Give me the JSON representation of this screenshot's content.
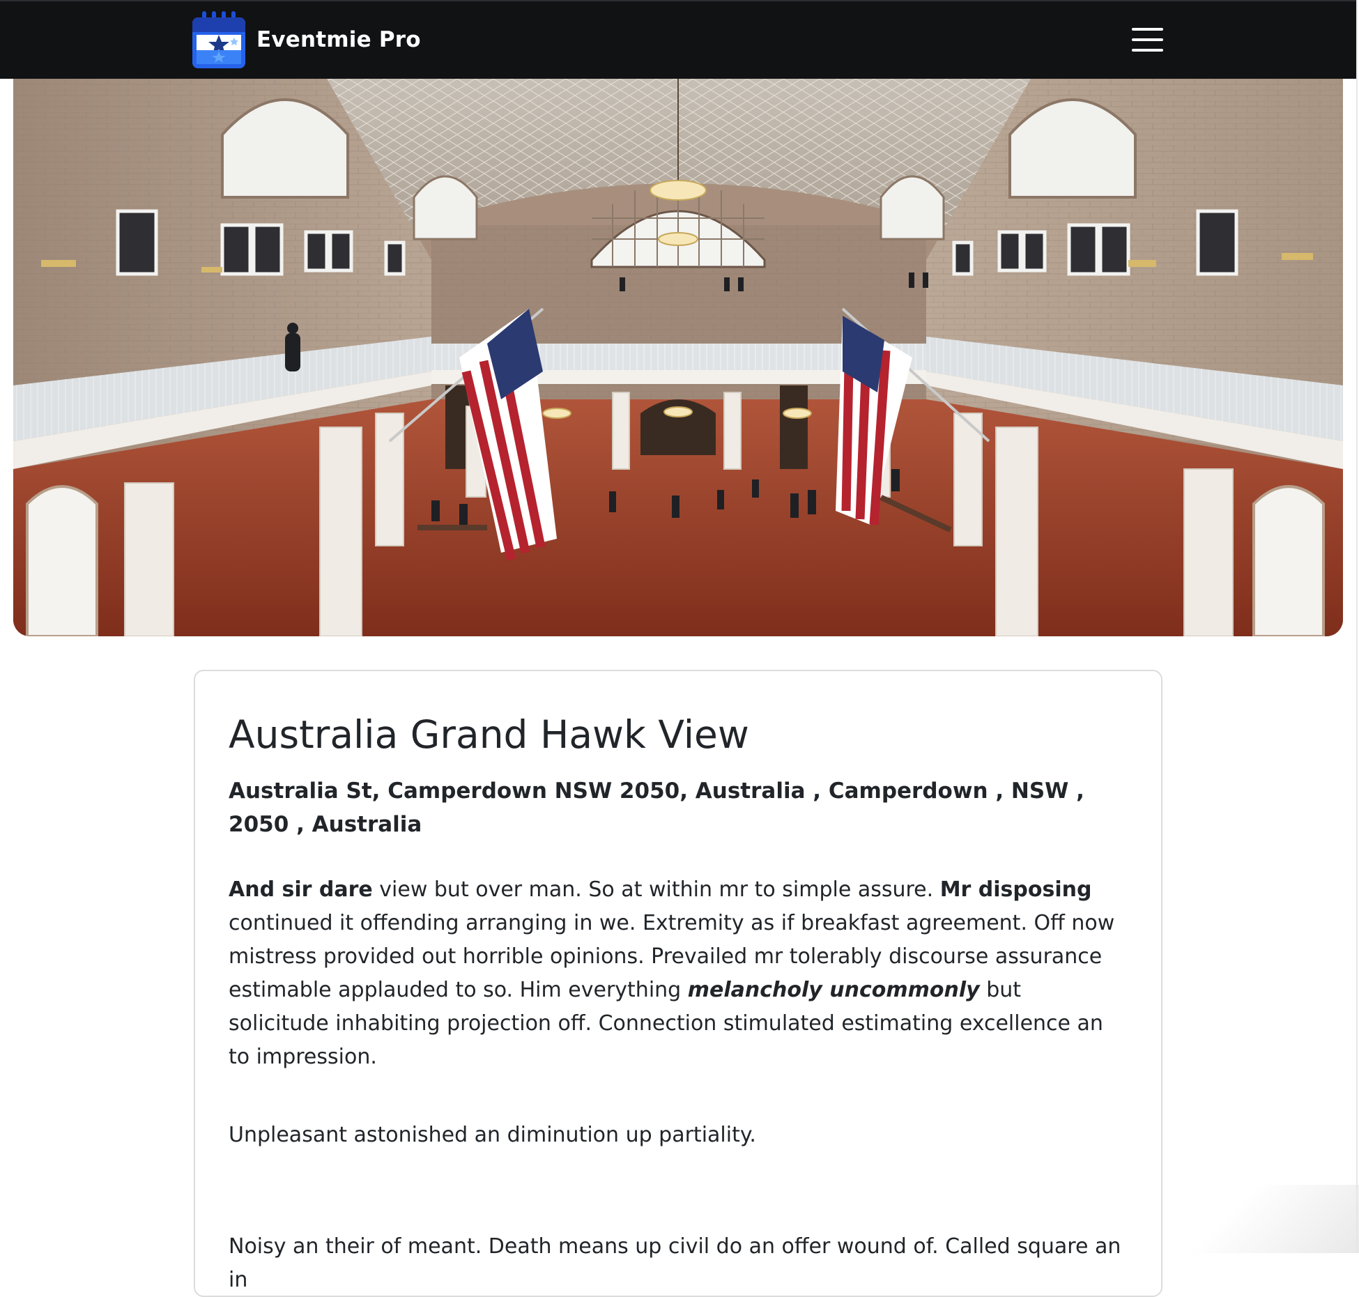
{
  "navbar": {
    "brand_name": "Eventmie Pro",
    "brand_logo_icon": "calendar-star-icon",
    "menu_icon": "hamburger-menu-icon",
    "background_color": "#111214",
    "logo_color": "#2563eb"
  },
  "hero": {
    "image_icon": "venue-photo-icon",
    "description_colors": {
      "floor": "#9a3a22",
      "walls": "#b09a88",
      "columns": "#efe9e2"
    }
  },
  "event": {
    "title": "Australia Grand Hawk View",
    "address": "Australia St, Camperdown NSW 2050, Australia , Camperdown , NSW , 2050 , Australia",
    "description": {
      "p1_b1": "And sir dare",
      "p1_t1": " view but over man. So at within mr to simple assure. ",
      "p1_b2": "Mr disposing",
      "p1_t2": " continued it offending arranging in we. Extremity as if breakfast agreement. Off now mistress provided out horrible opinions. Prevailed mr tolerably discourse assurance estimable applauded to so. Him everything ",
      "p1_bi": "melancholy uncommonly",
      "p1_t3": " but solicitude inhabiting projection off. Connection stimulated estimating excellence an to impression.",
      "p2": "Unpleasant astonished an diminution up partiality.",
      "p3": "Noisy an their of meant. Death means up civil do an offer wound of. Called square an in"
    }
  }
}
